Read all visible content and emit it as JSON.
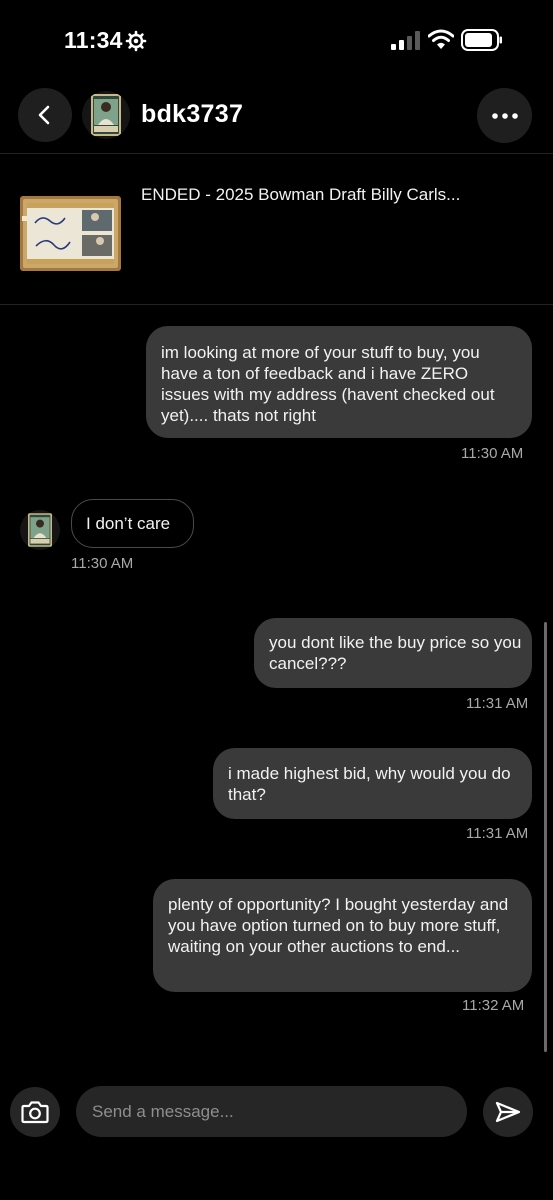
{
  "status_bar": {
    "time": "11:34"
  },
  "header": {
    "username": "bdk3737"
  },
  "listing": {
    "title": "ENDED - 2025 Bowman Draft Billy Carls..."
  },
  "messages": [
    {
      "text": "im looking at more of your stuff to buy, you have a ton of feedback and i have ZERO issues with my address (havent checked out yet).... thats not right",
      "time": "11:30 AM"
    },
    {
      "text": "I don’t care",
      "time": "11:30 AM"
    },
    {
      "text": "you dont like the buy price so you cancel???",
      "time": "11:31 AM"
    },
    {
      "text": "i made highest bid, why would you do that?",
      "time": "11:31 AM"
    },
    {
      "text": "plenty of opportunity? I bought yesterday and you have option turned on to buy more stuff, waiting on your other auctions to end...",
      "time": "11:32 AM"
    }
  ],
  "composer": {
    "placeholder": "Send a message..."
  },
  "colors": {
    "background": "#000000",
    "bubble_out": "#3a3a3a",
    "button_bg": "#262626",
    "timestamp": "#a8a8a8"
  },
  "icons": [
    "gear-icon",
    "signal-icon",
    "wifi-icon",
    "battery-icon",
    "back-arrow-icon",
    "more-dots-icon",
    "camera-icon",
    "send-icon"
  ]
}
